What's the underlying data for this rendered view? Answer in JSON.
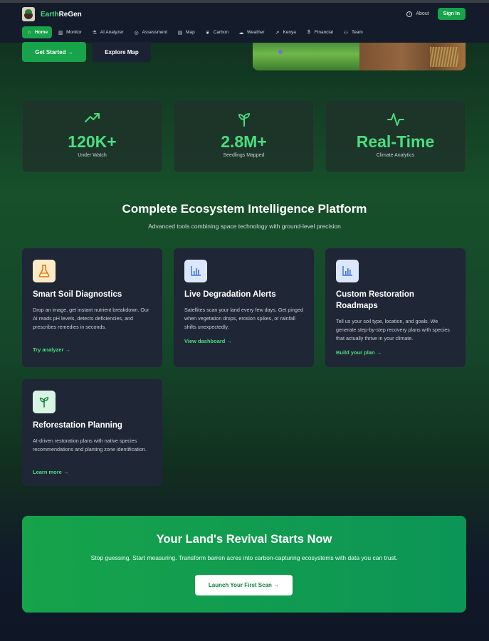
{
  "nav": {
    "brand_part1": "Earth",
    "brand_part2": "ReGen",
    "about_label": "About",
    "signin_label": "Sign In",
    "tabs": [
      {
        "label": "Home",
        "icon": "home-icon"
      },
      {
        "label": "Monitor",
        "icon": "bar-chart-icon"
      },
      {
        "label": "AI Analyzer",
        "icon": "flask-icon"
      },
      {
        "label": "Assessment",
        "icon": "check-circle-icon"
      },
      {
        "label": "Map",
        "icon": "map-icon"
      },
      {
        "label": "Carbon",
        "icon": "leaf-icon"
      },
      {
        "label": "Weather",
        "icon": "cloud-icon"
      },
      {
        "label": "Kenya",
        "icon": "trend-icon"
      },
      {
        "label": "Financial",
        "icon": "dollar-icon"
      },
      {
        "label": "Team",
        "icon": "users-icon"
      }
    ],
    "active_tab": "Home"
  },
  "hero": {
    "get_started_label": "Get Started →",
    "explore_map_label": "Explore Map"
  },
  "stats": [
    {
      "value": "120K+",
      "label": "Under Watch",
      "icon": "trending-up-icon"
    },
    {
      "value": "2.8M+",
      "label": "Seedlings Mapped",
      "icon": "sprout-icon"
    },
    {
      "value": "Real-Time",
      "label": "Climate Analytics",
      "icon": "activity-icon"
    }
  ],
  "features": {
    "title": "Complete Ecosystem Intelligence Platform",
    "subtitle": "Advanced tools combining space technology with ground-level precision",
    "cards": [
      {
        "title": "Smart Soil Diagnostics",
        "description": "Drop an image, get instant nutrient breakdown. Our AI reads pH levels, detects deficiencies, and prescribes remedies in seconds.",
        "link": "Try analyzer →",
        "icon": "flask-icon"
      },
      {
        "title": "Live Degradation Alerts",
        "description": "Satellites scan your land every few days. Get pinged when vegetation drops, erosion spikes, or rainfall shifts unexpectedly.",
        "link": "View dashboard →",
        "icon": "bar-chart-icon"
      },
      {
        "title": "Custom Restoration Roadmaps",
        "description": "Tell us your soil type, location, and goals. We generate step-by-step recovery plans with species that actually thrive in your climate.",
        "link": "Build your plan →",
        "icon": "bar-chart-icon"
      },
      {
        "title": "Reforestation Planning",
        "description": "AI-driven restoration plans with native species recommendations and planting zone identification.",
        "link": "Learn more →",
        "icon": "sprout-icon"
      }
    ]
  },
  "cta": {
    "title": "Your Land's Revival Starts Now",
    "subtitle": "Stop guessing. Start measuring. Transform barren acres into carbon-capturing ecosystems with data you can trust.",
    "button_label": "Launch Your First Scan →"
  },
  "colors": {
    "accent": "#16a34a",
    "accent_text": "#4ade80",
    "card_bg": "#1f2636",
    "nav_bg": "#141b2b"
  }
}
